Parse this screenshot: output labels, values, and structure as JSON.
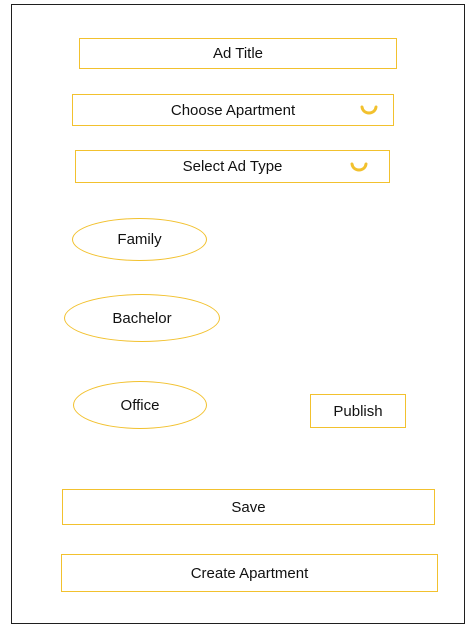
{
  "form": {
    "ad_title": "Ad Title",
    "choose_apartment": "Choose Apartment",
    "select_ad_type": "Select Ad Type",
    "ad_types": [
      "Family",
      "Bachelor",
      "Office"
    ],
    "publish": "Publish",
    "save": "Save",
    "create_apartment": "Create Apartment"
  },
  "icons": {
    "dropdown": "chevron-down-icon"
  },
  "colors": {
    "accent": "#f2c12e",
    "frame": "#1f1f1f",
    "background": "#ffffff"
  }
}
